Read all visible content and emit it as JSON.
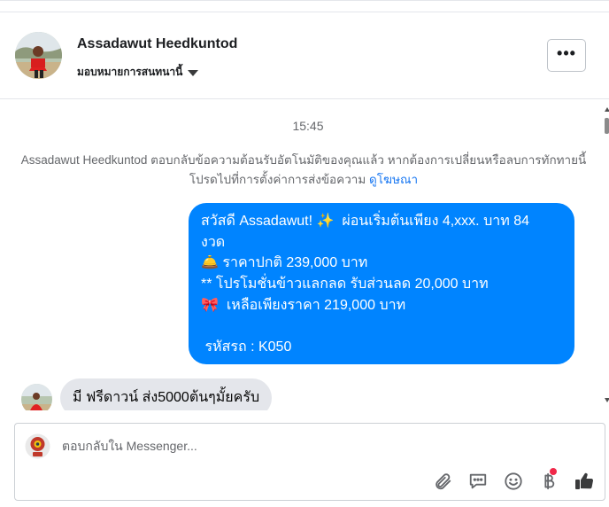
{
  "header": {
    "contact_name": "Assadawut Heedkuntod",
    "assign_label": "มอบหมายการสนทนานี้",
    "more_label": "•••"
  },
  "thread": {
    "timestamp": "15:45",
    "system_note": {
      "text": "Assadawut Heedkuntod ตอบกลับข้อความต้อนรับอัตโนมัติของคุณแล้ว หากต้องการเปลี่ยนหรือลบการทักทายนี้ โปรดไปที่การตั้งค่าการส่งข้อความ",
      "link": "ดูโฆษณา"
    },
    "outgoing_message": {
      "lines": [
        "สวัสดี Assadawut! ✨  ผ่อนเริ่มต้นเพียง 4,xxx. บาท 84",
        "งวด",
        "🛎️ ราคาปกติ 239,000 บาท",
        "** โปรโมชั่นข้าวแลกลด รับส่วนลด 20,000 บาท",
        "🎀  เหลือเพียงราคา 219,000 บาท",
        "",
        " รหัสรถ : K050"
      ]
    },
    "incoming_message": {
      "text": "มี ฟรีดาวน์ ส่ง5000ต้นๆมั้ยครับ"
    }
  },
  "composer": {
    "placeholder": "ตอบกลับใน Messenger...",
    "tools": [
      "paperclip-icon",
      "saved-reply-icon",
      "emoji-icon",
      "baht-payment-icon",
      "like-icon"
    ],
    "accent_color": "#0084ff",
    "notification_color": "#f02849"
  }
}
